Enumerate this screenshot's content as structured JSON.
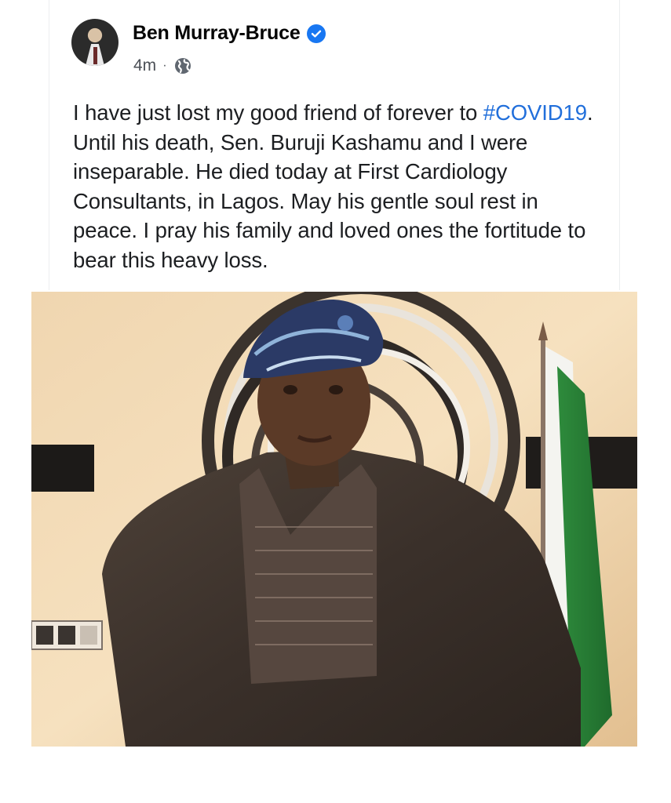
{
  "post": {
    "author": "Ben Murray-Bruce",
    "time": "4m",
    "separator": "·",
    "text_before": "I have just lost my good friend of forever to ",
    "hashtag": "#COVID19",
    "text_after": ". Until his death, Sen. Buruji Kashamu and I were inseparable. He died today at First Cardiology Consultants, in Lagos. May his gentle soul rest in peace. I pray his family and loved ones the fortitude to bear this heavy loss."
  },
  "icons": {
    "verified": "verified-badge-icon",
    "audience": "globe-icon"
  },
  "colors": {
    "hashtag": "#216fdb",
    "verified": "#1877f2",
    "text": "#1c1e21",
    "meta": "#4b4f56"
  }
}
